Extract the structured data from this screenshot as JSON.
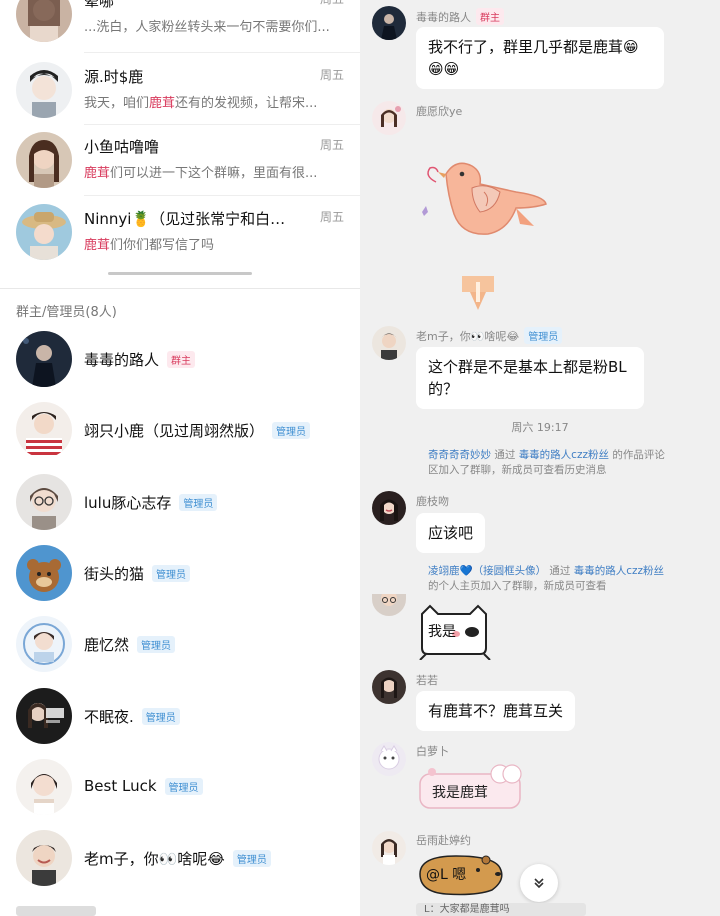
{
  "chat_list": [
    {
      "name": "晕哪",
      "time": "周五",
      "preview_prefix": "",
      "preview": "...洗白，人家粉丝转头来一句不需要你们..."
    },
    {
      "name": "源.时$鹿",
      "time": "周五",
      "preview_prefix": "我天，咱们",
      "preview_hl": "鹿茸",
      "preview": "还有的发视频，让帮宋..."
    },
    {
      "name": "小鱼咕噜噜",
      "time": "周五",
      "preview_prefix": "",
      "preview_hl": "鹿茸",
      "preview": "们可以进一下这个群嘛，里面有很..."
    },
    {
      "name": "Ninnyi🍍（见过张常宁和白…",
      "time": "周五",
      "preview_prefix": "",
      "preview_hl": "鹿茸",
      "preview": "们你们都写信了吗"
    }
  ],
  "section_title": "群主/管理员(8人)",
  "members": [
    {
      "name": "毒毒的路人",
      "badge": "群主",
      "role": "owner"
    },
    {
      "name": "翊只小鹿（见过周翊然版）",
      "badge": "管理员",
      "role": "admin"
    },
    {
      "name": "lulu豚心志存",
      "badge": "管理员",
      "role": "admin"
    },
    {
      "name": "街头的猫",
      "badge": "管理员",
      "role": "admin"
    },
    {
      "name": "鹿忆然",
      "badge": "管理员",
      "role": "admin"
    },
    {
      "name": "不眠夜.",
      "badge": "管理员",
      "role": "admin"
    },
    {
      "name": "Best Luck",
      "badge": "管理员",
      "role": "admin"
    },
    {
      "name": "老m子，你👀啥呢😂",
      "badge": "管理员",
      "role": "admin"
    }
  ],
  "messages": {
    "m1": {
      "sender": "毒毒的路人",
      "badge": "群主",
      "text_line1": "我不行了，群里几乎都是鹿茸😁",
      "text_line2": "😁😁"
    },
    "m2": {
      "sender": "鹿愿欣ye"
    },
    "m3": {
      "sender": "老m子，你👀啥呢😂",
      "badge": "管理员",
      "text_line1": "这个群是不是基本上都是粉BL",
      "text_line2": "的？"
    },
    "time_sep": "周六 19:17",
    "sys1": {
      "user": "奇奇奇奇妙妙",
      "mid": " 通过 ",
      "via": "毒毒的路人czz粉丝",
      "rest": " 的作品评论区加入了群聊，新成员可查看历史消息"
    },
    "m4": {
      "sender": "鹿枝吻",
      "text": "应该吧"
    },
    "sys2": {
      "user": "凌翊鹿💙（接圆框头像）",
      "mid": " 通过 ",
      "via": "毒毒的路人czz粉丝",
      "rest": " 的个人主页加入了群聊，新成员可查看"
    },
    "m5": {
      "sticker_text": "我是"
    },
    "m6": {
      "sender": "若若",
      "text": "有鹿茸不？鹿茸互关"
    },
    "m7": {
      "sender": "白萝卜",
      "sticker_text": "我是鹿茸"
    },
    "m8": {
      "sender": "岳雨赴婷约",
      "sticker_text": "@L 嗯"
    },
    "quote": "L：大家都是鹿茸吗"
  },
  "colors": {
    "highlight": "#d83b5d",
    "admin": "#3f8fd2",
    "link": "#3f7ec4"
  },
  "icons": {
    "scroll_down": "chevron-double-down-icon"
  }
}
